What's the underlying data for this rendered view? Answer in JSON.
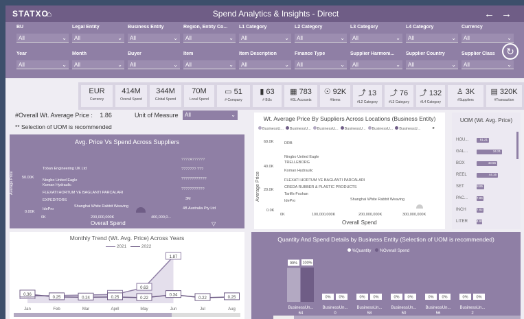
{
  "header": {
    "logo": "STATXO",
    "title": "Spend Analytics & Insights - Direct",
    "back": "←",
    "forward": "→"
  },
  "filters": [
    {
      "label": "BU",
      "value": "All"
    },
    {
      "label": "Legal Entity",
      "value": "All"
    },
    {
      "label": "Business Entity",
      "value": "All"
    },
    {
      "label": "Region, Entity Co...",
      "value": "All"
    },
    {
      "label": "L1 Category",
      "value": "All"
    },
    {
      "label": "L2 Category",
      "value": "All"
    },
    {
      "label": "L3 Category",
      "value": "All"
    },
    {
      "label": "L4 Category",
      "value": "All"
    },
    {
      "label": "Currency",
      "value": "All"
    },
    {
      "label": "Year",
      "value": "All"
    },
    {
      "label": "Month",
      "value": "All"
    },
    {
      "label": "Buyer",
      "value": "All"
    },
    {
      "label": "Item",
      "value": "All"
    },
    {
      "label": "Item Description",
      "value": "All"
    },
    {
      "label": "Finance Type",
      "value": "All"
    },
    {
      "label": "Supplier Harmoni...",
      "value": "All"
    },
    {
      "label": "Supplier Country",
      "value": "All"
    },
    {
      "label": "Supplier Class",
      "value": "All"
    }
  ],
  "kpis": [
    {
      "value": "EUR",
      "label": "Currency"
    },
    {
      "value": "414M",
      "label": "Overall Spend"
    },
    {
      "value": "344M",
      "label": "Global Spend"
    },
    {
      "value": "70M",
      "label": "Local Spend"
    },
    {
      "value": "51",
      "label": "# Company"
    },
    {
      "value": "63",
      "label": "# BUs"
    },
    {
      "value": "783",
      "label": "#GL Accounts"
    },
    {
      "value": "92K",
      "label": "#Items"
    },
    {
      "value": "13",
      "label": "#L2 Category"
    },
    {
      "value": "76",
      "label": "#L3 Category"
    },
    {
      "value": "132",
      "label": "#L4 Category"
    },
    {
      "value": "3K",
      "label": "#Suppliers"
    },
    {
      "value": "320K",
      "label": "#Transaction"
    }
  ],
  "info": {
    "overall_label": "#Overall Wt. Average Price :",
    "overall_value": "1.86",
    "uom_label": "Unit of Measure",
    "uom_value": "All",
    "note": "** Selection of UOM is recommended"
  },
  "scatter1": {
    "title": "Avg. Price Vs Spend Across Suppliers",
    "ylabel": "Average Price",
    "xlabel": "Overall Spend",
    "y_ticks": [
      "50.00K",
      "0.00K"
    ],
    "x_ticks": [
      "0K",
      "200,000,000K",
      "400,000,0..."
    ],
    "labels": [
      "Toban Engineering UK Ltd",
      "Ningbo United Eagle",
      "Koman Hydraulic",
      "FLEXATI HORTUM VE BAGLANTI PARCALARI",
      "EXPEDITORS",
      "IdePro",
      "Shanghai White Rabbit Weaving"
    ],
    "right_labels": [
      "????A??????",
      "??????? ???",
      "????????????",
      "???????????",
      "3M",
      "4B Australia Pty Ltd"
    ]
  },
  "scatter2": {
    "title": "Wt. Average Price By Suppliers Across Locations (Business Entity)",
    "legend": [
      "BusinessU...",
      "BusinessU...",
      "BusinessU...",
      "BusinessU...",
      "BusinessU...",
      "BusinessU..."
    ],
    "ylabel": "Average Price",
    "xlabel": "Overall Spend",
    "y_ticks": [
      "60.0K",
      "40.0K",
      "20.0K",
      "0.0K"
    ],
    "x_ticks": [
      "0K",
      "100,000,000K",
      "200,000,000K",
      "300,000,000K"
    ],
    "labels": [
      "DRB",
      "Ningbo United Eagle",
      "TRELLEBORG",
      "Koman Hydraulic",
      "FLEXATI HORTUM VE BAGLANTI PARCALARI",
      "CREDA RUBBER & PLASTIC PRODUCTS",
      "Tariffs-Foshan",
      "IdePro",
      "Shanghai White Rabbit Weaving"
    ]
  },
  "uom": {
    "title": "UOM (Wt. Avg. Price)",
    "rows": [
      {
        "name": "HOU...",
        "value": "81.21",
        "pct": 0.36
      },
      {
        "name": "GAL...",
        "value": "34.21",
        "pct": 0.74
      },
      {
        "name": "BOX",
        "value": "43.56",
        "pct": 0.6
      },
      {
        "name": "REEL",
        "value": "44.16",
        "pct": 0.62
      },
      {
        "name": "SET",
        "value": "8.85",
        "pct": 0.22
      },
      {
        "name": "PAC...",
        "value": "7.86",
        "pct": 0.2
      },
      {
        "name": "INCH",
        "value": "7.82",
        "pct": 0.2
      },
      {
        "name": "LITER",
        "value": "4.91",
        "pct": 0.16
      }
    ]
  },
  "chart_data": [
    {
      "type": "line",
      "title": "Monthly Trend (Wt. Avg. Price) Across Years",
      "categories": [
        "Jan",
        "Feb",
        "Mar",
        "April",
        "May",
        "Jun",
        "Jul",
        "Aug"
      ],
      "series": [
        {
          "name": "2021",
          "values": [
            0.29,
            null,
            null,
            0.35,
            0.63,
            1.87,
            null,
            null
          ]
        },
        {
          "name": "2022",
          "values": [
            0.36,
            0.25,
            0.24,
            0.25,
            0.22,
            0.34,
            0.22,
            0.25
          ]
        }
      ]
    },
    {
      "type": "bar",
      "title": "Quantity And Spend Details by Business Entity (Selection of UOM is recommended)",
      "legend": [
        "%Quantity",
        "%Overall Spend"
      ],
      "categories": [
        "BusinessUn...",
        "BusinessUn...",
        "BusinessUn...",
        "BusinessUn...",
        "BusinessUn...",
        "BusinessUn..."
      ],
      "category_values": [
        "64",
        "0",
        "58",
        "50",
        "56",
        "2"
      ],
      "series": [
        {
          "name": "%Quantity",
          "values": [
            99,
            0,
            0,
            0,
            0,
            0
          ]
        },
        {
          "name": "%Overall Spend",
          "values": [
            100,
            0,
            0,
            0,
            0,
            0
          ]
        }
      ],
      "labels": [
        [
          "99%",
          "100%"
        ],
        [
          "0%",
          "0%"
        ],
        [
          "0%",
          "0%"
        ],
        [
          "0%",
          "0%"
        ],
        [
          "0%",
          "0%"
        ],
        [
          "0%",
          "0%"
        ]
      ]
    }
  ]
}
